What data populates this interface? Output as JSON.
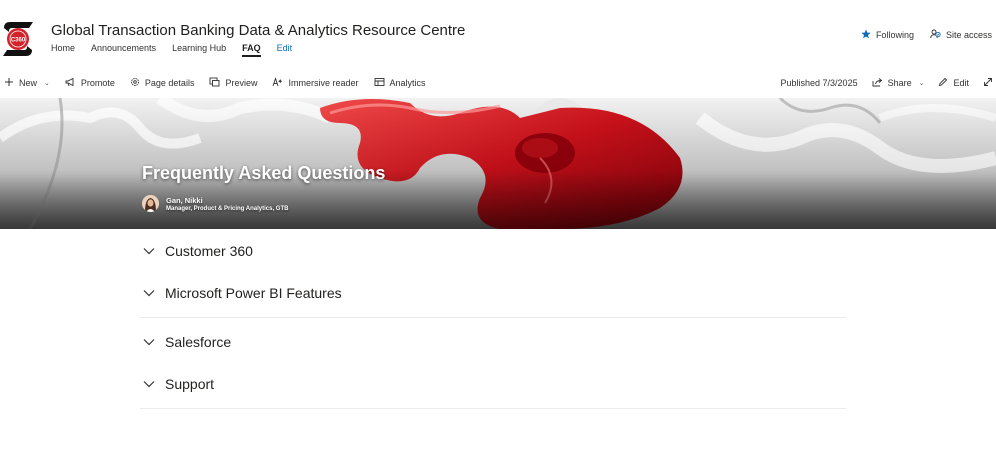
{
  "site": {
    "title": "Global Transaction Banking Data & Analytics Resource Centre",
    "logo_text": "C360",
    "nav": [
      "Home",
      "Announcements",
      "Learning Hub",
      "FAQ",
      "Edit"
    ],
    "active_nav": "FAQ",
    "following_label": "Following",
    "site_access_label": "Site access"
  },
  "command_bar": {
    "new_label": "New",
    "promote_label": "Promote",
    "page_details_label": "Page details",
    "preview_label": "Preview",
    "immersive_reader_label": "Immersive reader",
    "analytics_label": "Analytics",
    "published_text": "Published 7/3/2025",
    "share_label": "Share",
    "edit_label": "Edit"
  },
  "hero": {
    "title": "Frequently Asked Questions",
    "author_name": "Gan, Nikki",
    "author_role": "Manager, Product & Pricing Analytics, GTB"
  },
  "faq_sections": [
    {
      "items": [
        "Customer 360",
        "Microsoft Power BI Features"
      ]
    },
    {
      "items": [
        "Salesforce",
        "Support"
      ]
    }
  ],
  "colors": {
    "brand_red": "#d2232a",
    "link_blue": "#0f6cbd",
    "text": "#323130"
  },
  "icons": {
    "following": "star-icon",
    "site_access": "people-icon",
    "new": "plus-icon",
    "promote": "megaphone-icon",
    "page_details": "gear-icon",
    "preview": "preview-icon",
    "immersive_reader": "immersive-reader-icon",
    "analytics": "analytics-icon",
    "share": "share-icon",
    "edit": "pencil-icon",
    "expand": "expand-icon",
    "accordion": "chevron-down-icon"
  }
}
